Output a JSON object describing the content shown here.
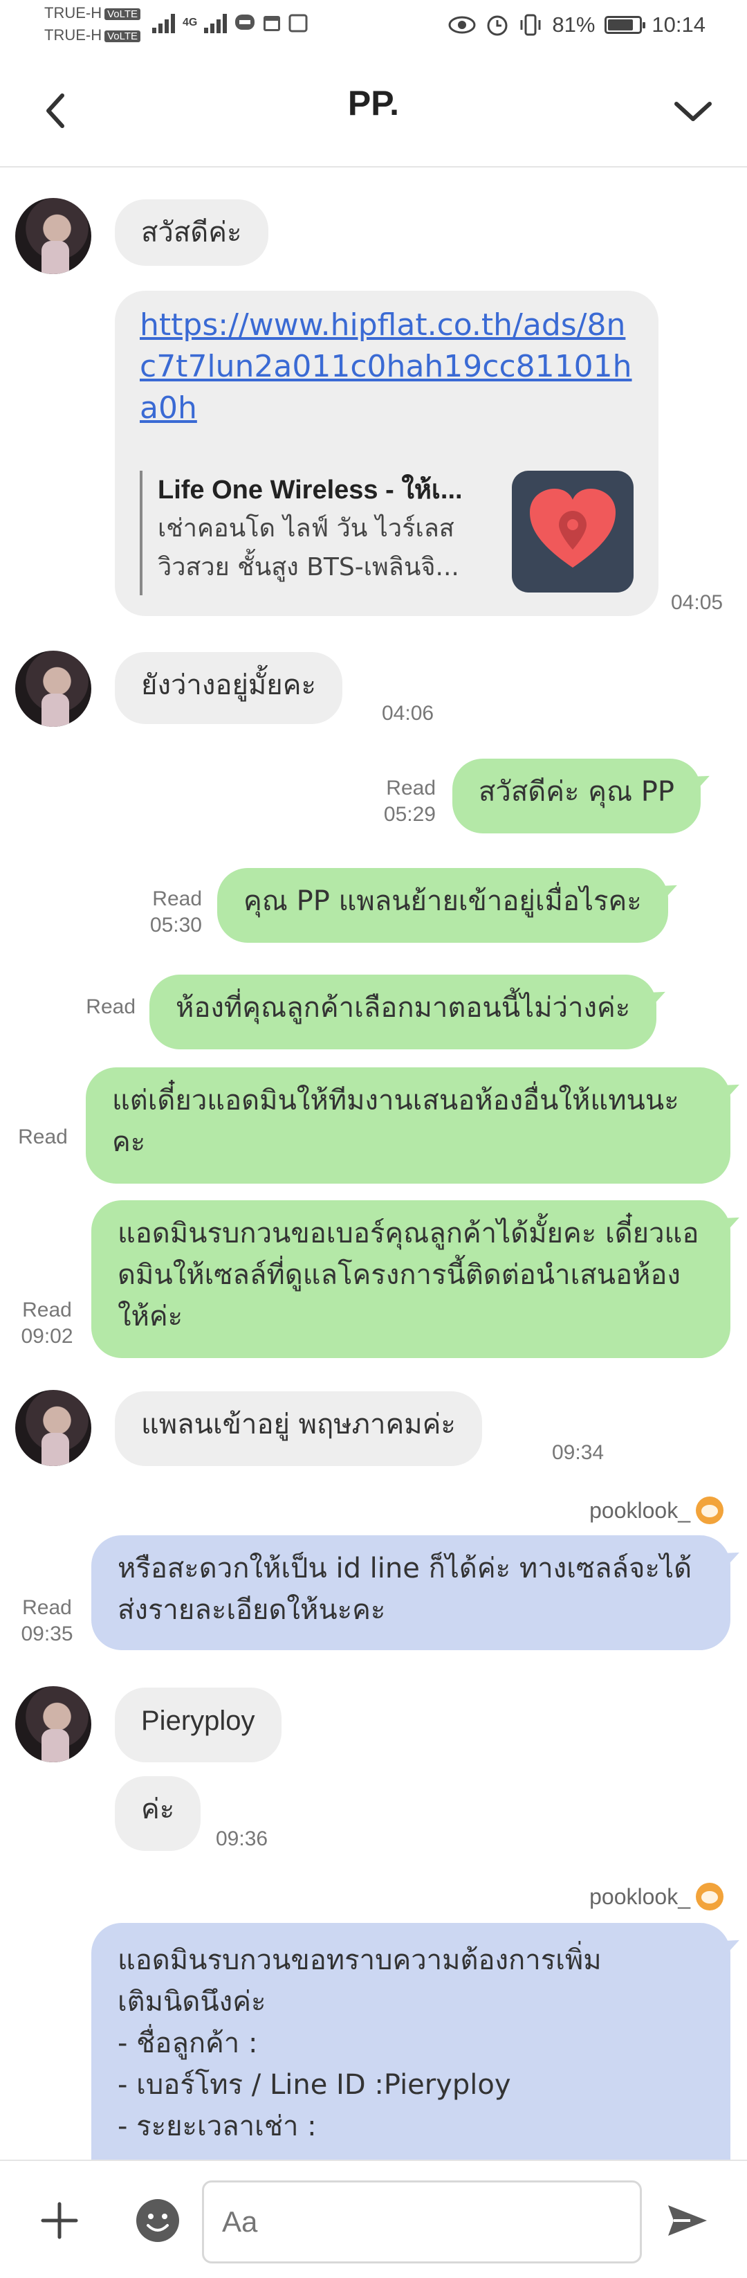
{
  "status_bar": {
    "carrier1": "TRUE-H",
    "carrier2": "TRUE-H",
    "volte": "VoLTE",
    "network": "4G",
    "battery_percent": "81%",
    "battery_level": 0.81,
    "time": "10:14"
  },
  "header": {
    "title": "PP.",
    "back_icon": "back-arrow-icon",
    "menu_icon": "chevron-down-icon"
  },
  "messages": [
    {
      "text": "สวัสดีค่ะ"
    },
    {
      "link": "https://www.hipflat.co.th/ads/8nc7t7lun2a011c0hah19cc81101ha0h",
      "preview_title": "Life One Wireless - ให้เ...",
      "preview_desc": "เช่าคอนโด ไลฟ์ วัน ไวร์เลส วิวสวย ชั้นสูง BTS-เพลินจิ...",
      "time": "04:05"
    },
    {
      "text": "ยังว่างอยู่มั้ยคะ",
      "time": "04:06"
    },
    {
      "text": "สวัสดีค่ะ คุณ PP",
      "read": "Read",
      "time": "05:29"
    },
    {
      "text": "คุณ PP แพลนย้ายเข้าอยู่เมื่อไรคะ",
      "read": "Read",
      "time": "05:30"
    },
    {
      "text": "ห้องที่คุณลูกค้าเลือกมาตอนนี้ไม่ว่างค่ะ",
      "read": "Read"
    },
    {
      "text": "แต่เดี๋ยวแอดมินให้ทีมงานเสนอห้องอื่นให้แทนนะคะ",
      "read": "Read"
    },
    {
      "text": "แอดมินรบกวนขอเบอร์คุณลูกค้าได้มั้ยคะ เดี๋ยวแอดมินให้เซลล์ที่ดูแลโครงการนี้ติดต่อนำเสนอห้องให้ค่ะ",
      "read": "Read",
      "time": "09:02"
    },
    {
      "text": "แพลนเข้าอยู่ พฤษภาคมค่ะ",
      "time": "09:34"
    },
    {
      "sender": "pooklook_",
      "text": "หรือสะดวกให้เป็น id line ก็ได้ค่ะ ทางเซลล์จะได้ส่งรายละเอียดให้นะคะ",
      "read": "Read",
      "time": "09:35"
    },
    {
      "text": "Pieryploy"
    },
    {
      "text": "ค่ะ",
      "time": "09:36"
    },
    {
      "sender": "pooklook_",
      "lines": [
        "แอดมินรบกวนขอทราบความต้องการเพิ่ม",
        "เติมนิดนึงค่ะ",
        "- ชื่อลูกค้า :",
        "- เบอร์โทร / Line ID :Pieryploy",
        "- ระยะเวลาเช่า :"
      ]
    }
  ],
  "input_bar": {
    "placeholder": "Aa",
    "add_icon": "plus-icon",
    "emoji_icon": "emoji-icon",
    "send_icon": "send-icon"
  },
  "colors": {
    "incoming_bubble": "#eeeeee",
    "outgoing_bubble": "#b4e8a7",
    "moderator_bubble": "#ccd7f2",
    "link": "#3a6ad4"
  }
}
